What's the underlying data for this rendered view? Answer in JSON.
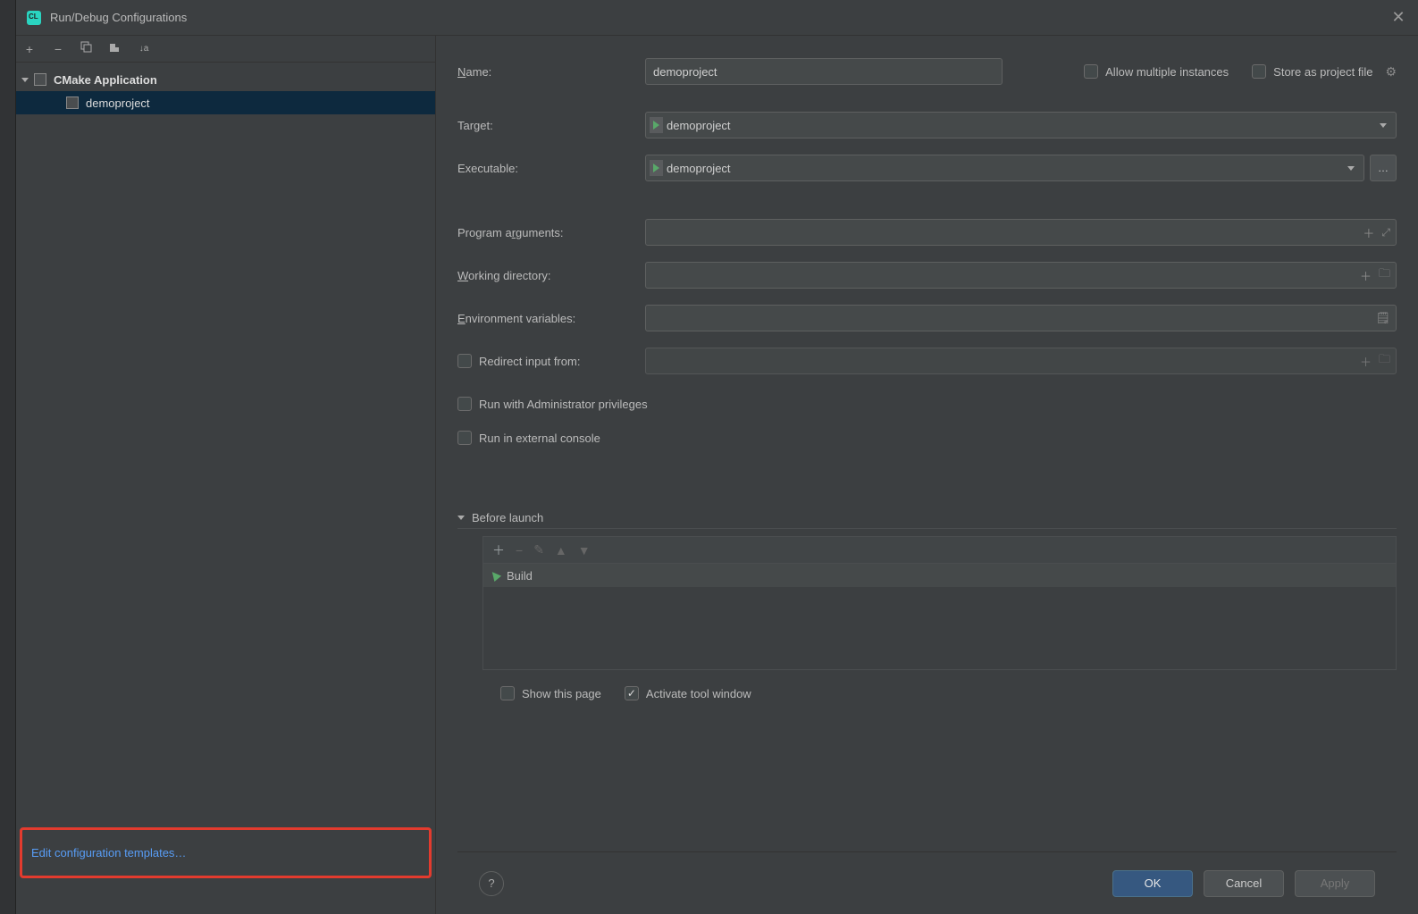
{
  "dialog": {
    "title": "Run/Debug Configurations"
  },
  "sidebar": {
    "group": "CMake Application",
    "items": [
      {
        "label": "demoproject"
      }
    ],
    "edit_templates": "Edit configuration templates…"
  },
  "toolbar": {
    "add": "+",
    "remove": "−"
  },
  "form": {
    "name_label": "Name:",
    "name_value": "demoproject",
    "allow_multiple": "Allow multiple instances",
    "store_as_file": "Store as project file",
    "target_label": "Target:",
    "target_value": "demoproject",
    "exe_label": "Executable:",
    "exe_value": "demoproject",
    "args_label": "Program arguments:",
    "args_value": "",
    "wd_label": "Working directory:",
    "wd_value": "",
    "env_label": "Environment variables:",
    "env_value": "",
    "redirect_label": "Redirect input from:",
    "redirect_value": "",
    "admin_label": "Run with Administrator privileges",
    "extconsole_label": "Run in external console"
  },
  "before": {
    "header": "Before launch",
    "items": [
      {
        "label": "Build"
      }
    ],
    "show_this_page": "Show this page",
    "activate_tool": "Activate tool window"
  },
  "footer": {
    "ok": "OK",
    "cancel": "Cancel",
    "apply": "Apply"
  }
}
